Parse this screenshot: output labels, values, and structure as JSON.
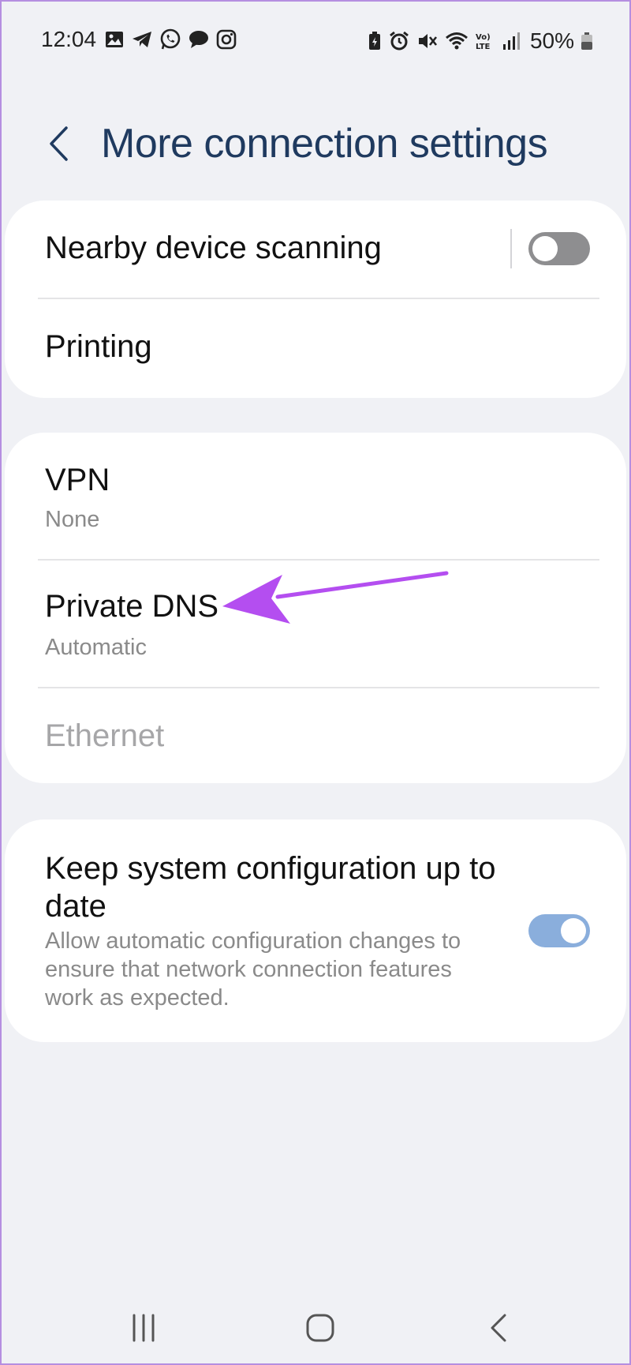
{
  "status_bar": {
    "time": "12:04",
    "battery": "50%",
    "left_icons": [
      "gallery-icon",
      "telegram-icon",
      "whatsapp-icon",
      "messages-icon",
      "instagram-icon"
    ],
    "right_icons": [
      "battery-saver-icon",
      "alarm-icon",
      "mute-icon",
      "wifi-icon",
      "volte-icon",
      "signal-icon",
      "battery-icon"
    ]
  },
  "header": {
    "title": "More connection settings"
  },
  "card1": {
    "nearby_scanning": {
      "label": "Nearby device scanning",
      "enabled": false
    },
    "printing": {
      "label": "Printing"
    }
  },
  "card2": {
    "vpn": {
      "label": "VPN",
      "value": "None"
    },
    "private_dns": {
      "label": "Private DNS",
      "value": "Automatic"
    },
    "ethernet": {
      "label": "Ethernet",
      "disabled": true
    }
  },
  "card3": {
    "keep_config": {
      "label": "Keep system configuration up to date",
      "description": "Allow automatic configuration changes to ensure that network connection features work as expected.",
      "enabled": true
    }
  },
  "annotation": {
    "color": "#b44ef0"
  },
  "colors": {
    "title": "#1f3a5f",
    "toggle_on": "#8aaedc",
    "toggle_off": "#8e8e90",
    "background": "#f0f1f5"
  },
  "nav_bar": {
    "buttons": [
      "recents-icon",
      "home-icon",
      "back-icon"
    ]
  }
}
